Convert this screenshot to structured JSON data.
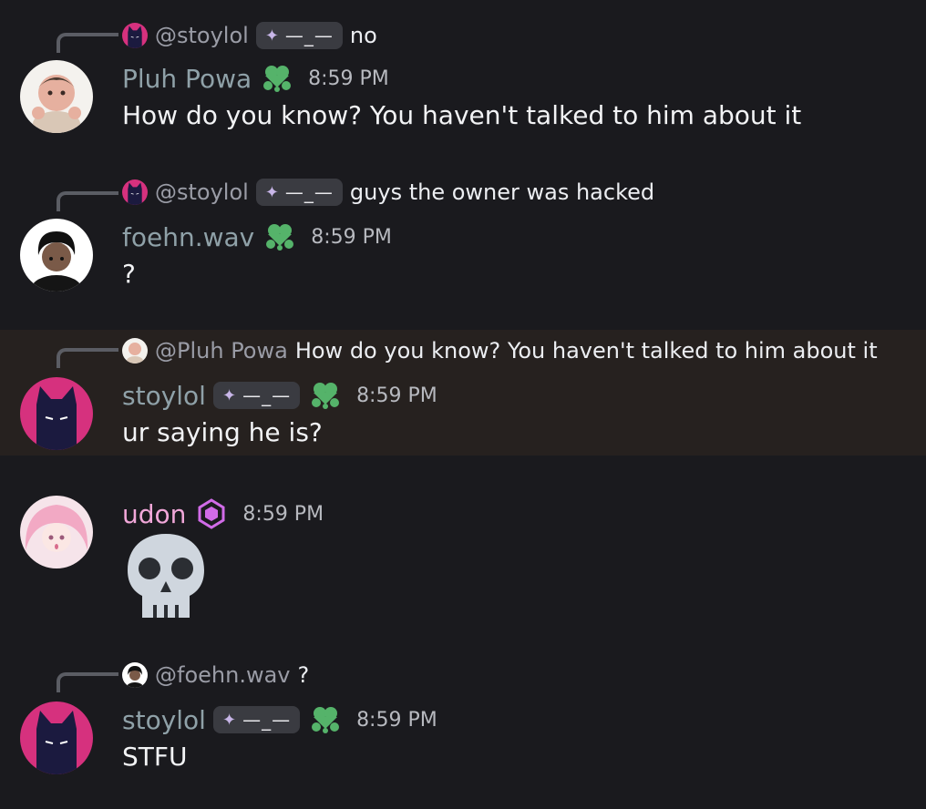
{
  "colors": {
    "background": "#1a1a1e",
    "highlight_row": "#26211f",
    "username_default": "#8fa1a8",
    "username_udon": "#f1a7d9",
    "clover": "#55b36a",
    "gem": "#d16be8"
  },
  "messages": [
    {
      "reply": {
        "author": "@stoylol",
        "tag": "—_—",
        "text": "no"
      },
      "author": "Pluh Powa",
      "badge": "clover-icon",
      "time": "8:59 PM",
      "content": "How do you know? You haven't talked to him about it"
    },
    {
      "reply": {
        "author": "@stoylol",
        "tag": "—_—",
        "text": "guys the owner was hacked"
      },
      "author": "foehn.wav",
      "badge": "clover-icon",
      "time": "8:59 PM",
      "content": "?"
    },
    {
      "reply": {
        "author": "@Pluh Powa",
        "text": "How do you know? You haven't talked to him about it"
      },
      "author": "stoylol",
      "tag": "—_—",
      "badge": "clover-icon",
      "time": "8:59 PM",
      "content": "ur saying he is?",
      "highlighted": true
    },
    {
      "author": "udon",
      "badge": "gem-icon",
      "time": "8:59 PM",
      "content_emoji": "skull-emoji"
    },
    {
      "reply": {
        "author": "@foehn.wav",
        "text": "?"
      },
      "author": "stoylol",
      "tag": "—_—",
      "badge": "clover-icon",
      "time": "8:59 PM",
      "content": "STFU"
    }
  ]
}
